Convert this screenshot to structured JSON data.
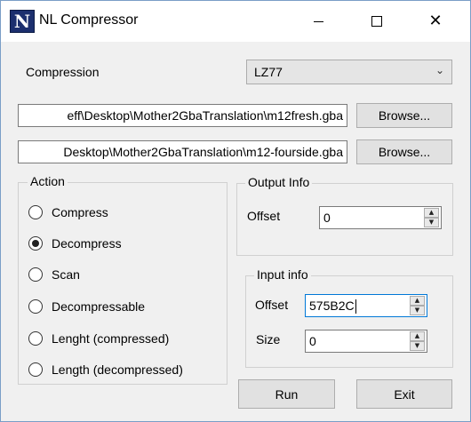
{
  "window": {
    "title": "NL Compressor",
    "icon": "nl-app-icon",
    "icon_letter": "N"
  },
  "compression": {
    "label": "Compression",
    "selected": "LZ77"
  },
  "paths": {
    "input_value": "eff\\Desktop\\Mother2GbaTranslation\\m12fresh.gba",
    "output_value": "Desktop\\Mother2GbaTranslation\\m12-fourside.gba",
    "browse_label": "Browse..."
  },
  "action": {
    "title": "Action",
    "options": [
      {
        "label": "Compress",
        "checked": false
      },
      {
        "label": "Decompress",
        "checked": true
      },
      {
        "label": "Scan",
        "checked": false
      },
      {
        "label": "Decompressable",
        "checked": false
      },
      {
        "label": "Lenght (compressed)",
        "checked": false
      },
      {
        "label": "Length (decompressed)",
        "checked": false
      }
    ]
  },
  "output_info": {
    "title": "Output Info",
    "offset_label": "Offset",
    "offset_value": "0"
  },
  "input_info": {
    "title": "Input info",
    "offset_label": "Offset",
    "offset_value": "575B2C",
    "size_label": "Size",
    "size_value": "0"
  },
  "buttons": {
    "run": "Run",
    "exit": "Exit"
  }
}
